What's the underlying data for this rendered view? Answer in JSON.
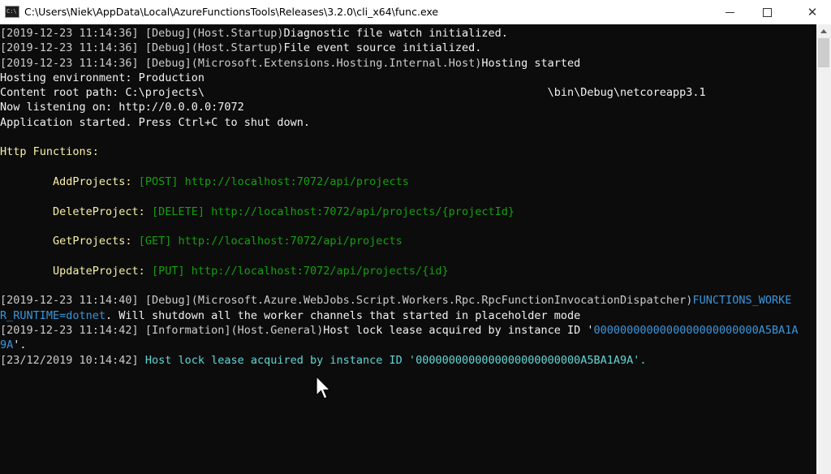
{
  "window": {
    "icon_text": "C:\\",
    "title": "C:\\Users\\Niek\\AppData\\Local\\AzureFunctionsTools\\Releases\\3.2.0\\cli_x64\\func.exe",
    "close_glyph": "✕"
  },
  "colors": {
    "console_bg": "#0c0c0c",
    "default_text": "#cccccc",
    "highlight_text": "#f9f1a5",
    "url_green": "#13a10e",
    "cyan": "#3a96dd"
  },
  "console": {
    "lines": [
      [
        {
          "t": "[2019-12-23 11:14:36] ",
          "c": "def"
        },
        {
          "t": "[Debug]",
          "c": "def"
        },
        {
          "t": "(Host.Startup)",
          "c": "def"
        },
        {
          "t": "Diagnostic file watch initialized.",
          "c": "white"
        }
      ],
      [
        {
          "t": "[2019-12-23 11:14:36] ",
          "c": "def"
        },
        {
          "t": "[Debug]",
          "c": "def"
        },
        {
          "t": "(Host.Startup)",
          "c": "def"
        },
        {
          "t": "File event source initialized.",
          "c": "white"
        }
      ],
      [
        {
          "t": "[2019-12-23 11:14:36] ",
          "c": "def"
        },
        {
          "t": "[Debug]",
          "c": "def"
        },
        {
          "t": "(Microsoft.Extensions.Hosting.Internal.Host)",
          "c": "def"
        },
        {
          "t": "Hosting started",
          "c": "white"
        }
      ],
      [
        {
          "t": "Hosting environment: Production",
          "c": "white"
        }
      ],
      [
        {
          "t": "Content root path: C:\\projects\\                                                    \\bin\\Debug\\netcoreapp3.1",
          "c": "white"
        }
      ],
      [
        {
          "t": "Now listening on: http://0.0.0.0:7072",
          "c": "white"
        }
      ],
      [
        {
          "t": "Application started. Press Ctrl+C to shut down.",
          "c": "white"
        }
      ],
      [],
      [
        {
          "t": "Http Functions:",
          "c": "yellow"
        }
      ],
      [],
      [
        {
          "t": "        AddProjects: ",
          "c": "yellow"
        },
        {
          "t": "[POST] http://localhost:7072/api/projects",
          "c": "green"
        }
      ],
      [],
      [
        {
          "t": "        DeleteProject: ",
          "c": "yellow"
        },
        {
          "t": "[DELETE] http://localhost:7072/api/projects/{projectId}",
          "c": "green"
        }
      ],
      [],
      [
        {
          "t": "        GetProjects: ",
          "c": "yellow"
        },
        {
          "t": "[GET] http://localhost:7072/api/projects",
          "c": "green"
        }
      ],
      [],
      [
        {
          "t": "        UpdateProject: ",
          "c": "yellow"
        },
        {
          "t": "[PUT] http://localhost:7072/api/projects/{id}",
          "c": "green"
        }
      ],
      [],
      [
        {
          "t": "[2019-12-23 11:14:40] ",
          "c": "def"
        },
        {
          "t": "[Debug]",
          "c": "def"
        },
        {
          "t": "(Microsoft.Azure.WebJobs.Script.Workers.Rpc.RpcFunctionInvocationDispatcher)",
          "c": "def"
        },
        {
          "t": "FUNCTIONS_WORKE",
          "c": "cyan"
        }
      ],
      [
        {
          "t": "R_RUNTIME=dotnet",
          "c": "cyan"
        },
        {
          "t": ". Will shutdown all the worker channels that started in placeholder mode",
          "c": "white"
        }
      ],
      [
        {
          "t": "[2019-12-23 11:14:42] ",
          "c": "def"
        },
        {
          "t": "[Information]",
          "c": "def"
        },
        {
          "t": "(Host.General)",
          "c": "def"
        },
        {
          "t": "Host lock lease acquired by instance ID '",
          "c": "white"
        },
        {
          "t": "0000000000000000000000000A5BA1A",
          "c": "cyan"
        }
      ],
      [
        {
          "t": "9A",
          "c": "cyan"
        },
        {
          "t": "'.",
          "c": "white"
        }
      ],
      [
        {
          "t": "[23/12/2019 10:14:42] ",
          "c": "def"
        },
        {
          "t": "Host lock lease acquired by instance ID '",
          "c": "cyan2"
        },
        {
          "t": "0000000000000000000000000A5BA1A9A",
          "c": "cyan2"
        },
        {
          "t": "'.",
          "c": "cyan2"
        }
      ]
    ]
  }
}
